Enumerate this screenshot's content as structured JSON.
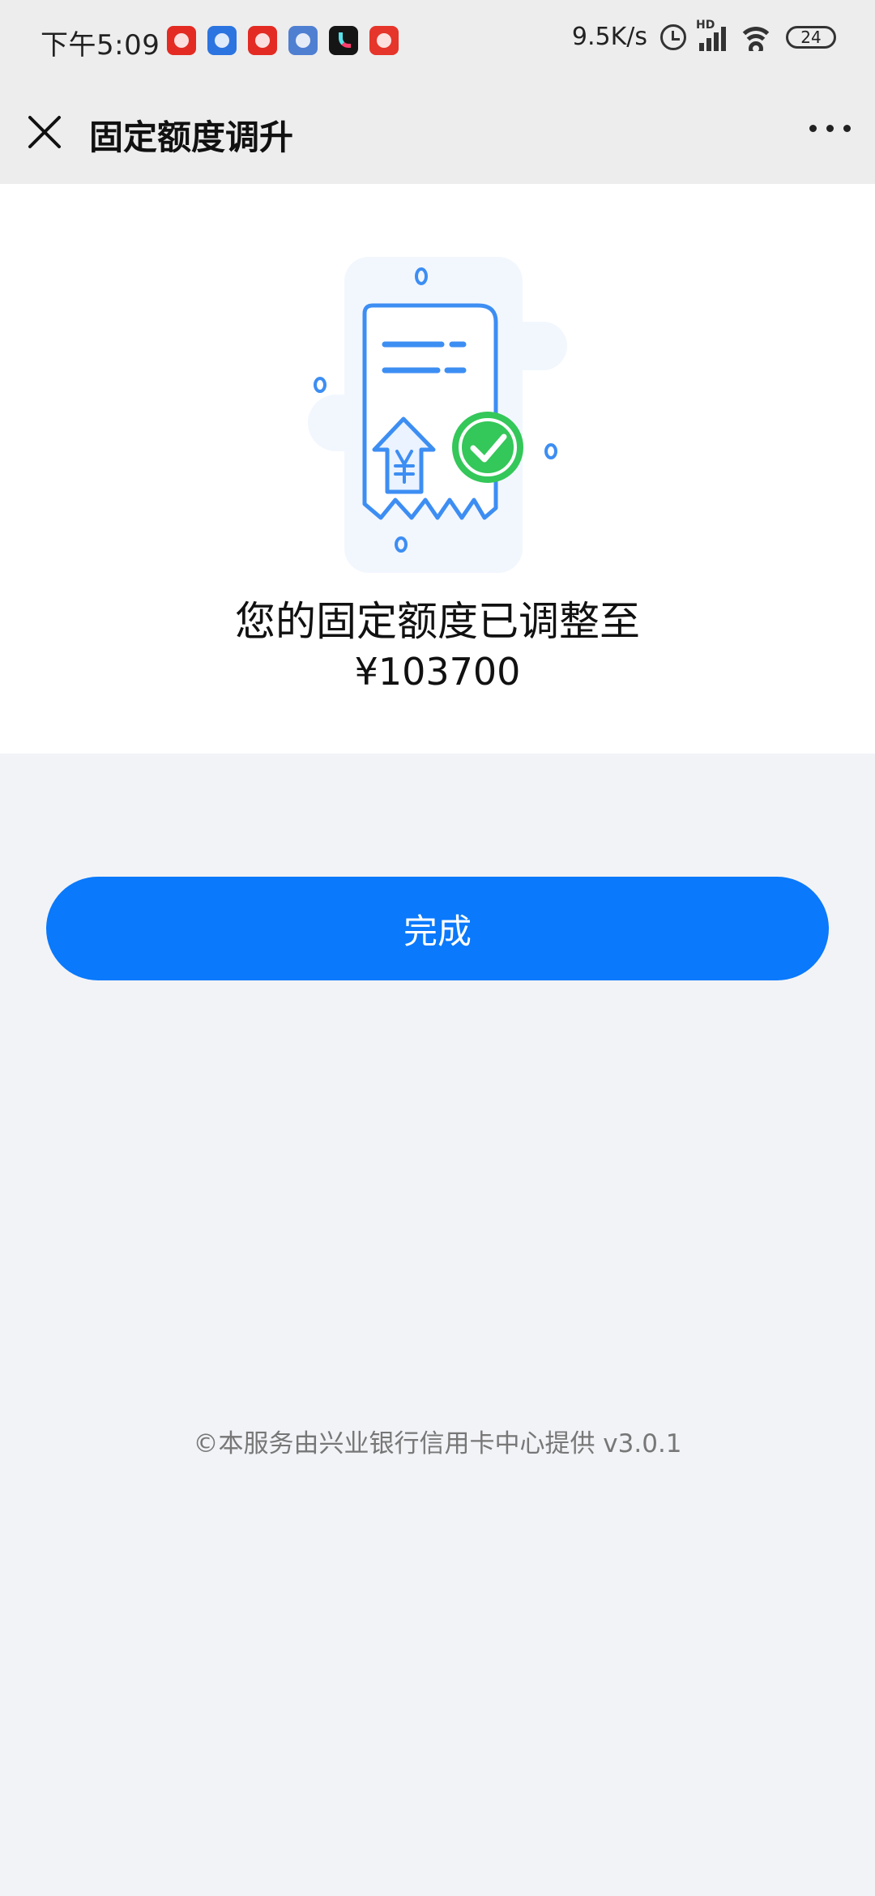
{
  "status_bar": {
    "time": "下午5:09",
    "network_speed": "9.5K/s",
    "hd_label": "HD",
    "battery": "24",
    "notification_icons": [
      "news-app-icon",
      "blue-app-icon",
      "red-chart-app-icon",
      "blue-chart-app-icon",
      "tiktok-icon",
      "red-bank-app-icon"
    ]
  },
  "nav": {
    "title": "固定额度调升"
  },
  "result": {
    "title": "您的固定额度已调整至",
    "amount": "¥103700"
  },
  "actions": {
    "done_label": "完成"
  },
  "footer": {
    "note": "©本服务由兴业银行信用卡中心提供 v3.0.1"
  },
  "colors": {
    "primary": "#0a79fb",
    "page_background": "#f2f3f7",
    "nav_background": "#ededed",
    "success": "#34c759"
  }
}
